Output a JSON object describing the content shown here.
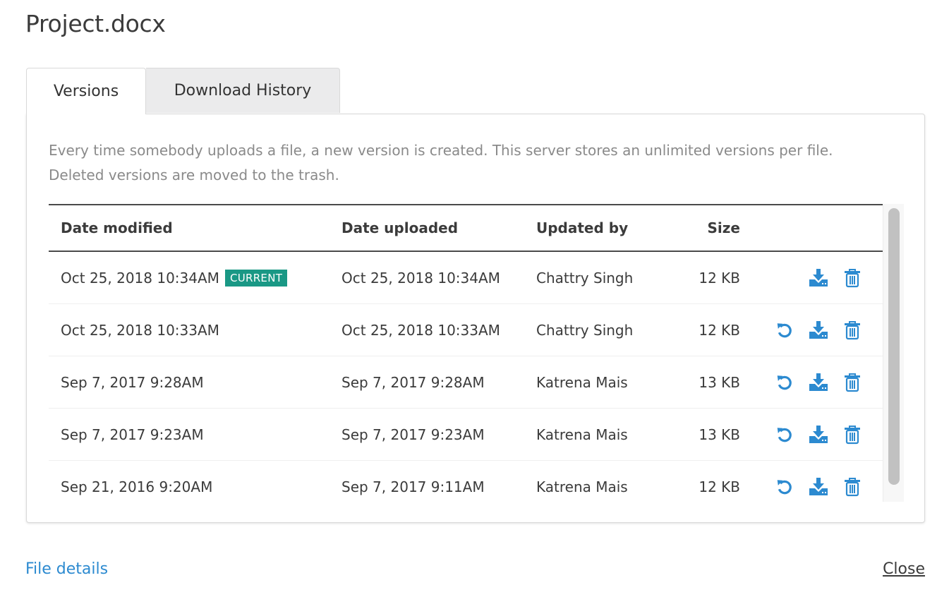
{
  "dialog": {
    "title": "Project.docx"
  },
  "tabs": [
    {
      "label": "Versions",
      "active": true
    },
    {
      "label": "Download History",
      "active": false
    }
  ],
  "versions_panel": {
    "description": "Every time somebody uploads a file, a new version is created. This server stores an unlimited versions per file. Deleted versions are moved to the trash.",
    "columns": [
      "Date modified",
      "Date uploaded",
      "Updated by",
      "Size",
      ""
    ],
    "rows": [
      {
        "date_modified": "Oct 25, 2018 10:34AM",
        "badge": "CURRENT",
        "date_uploaded": "Oct 25, 2018 10:34AM",
        "updated_by": "Chattry Singh",
        "size": "12 KB",
        "actions": [
          "download-icon",
          "trash-icon"
        ]
      },
      {
        "date_modified": "Oct 25, 2018 10:33AM",
        "badge": null,
        "date_uploaded": "Oct 25, 2018 10:33AM",
        "updated_by": "Chattry Singh",
        "size": "12 KB",
        "actions": [
          "restore-icon",
          "download-icon",
          "trash-icon"
        ]
      },
      {
        "date_modified": "Sep 7, 2017 9:28AM",
        "badge": null,
        "date_uploaded": "Sep 7, 2017 9:28AM",
        "updated_by": "Katrena Mais",
        "size": "13 KB",
        "actions": [
          "restore-icon",
          "download-icon",
          "trash-icon"
        ]
      },
      {
        "date_modified": "Sep 7, 2017 9:23AM",
        "badge": null,
        "date_uploaded": "Sep 7, 2017 9:23AM",
        "updated_by": "Katrena Mais",
        "size": "13 KB",
        "actions": [
          "restore-icon",
          "download-icon",
          "trash-icon"
        ]
      },
      {
        "date_modified": "Sep 21, 2016 9:20AM",
        "badge": null,
        "date_uploaded": "Sep 7, 2017 9:11AM",
        "updated_by": "Katrena Mais",
        "size": "12 KB",
        "actions": [
          "restore-icon",
          "download-icon",
          "trash-icon"
        ]
      }
    ]
  },
  "footer": {
    "file_details_label": "File details",
    "close_label": "Close"
  },
  "colors": {
    "accent_blue": "#2c8ad0",
    "badge_teal": "#1a9885",
    "text": "#3b3b3b",
    "muted_text": "#8a8a8a"
  }
}
